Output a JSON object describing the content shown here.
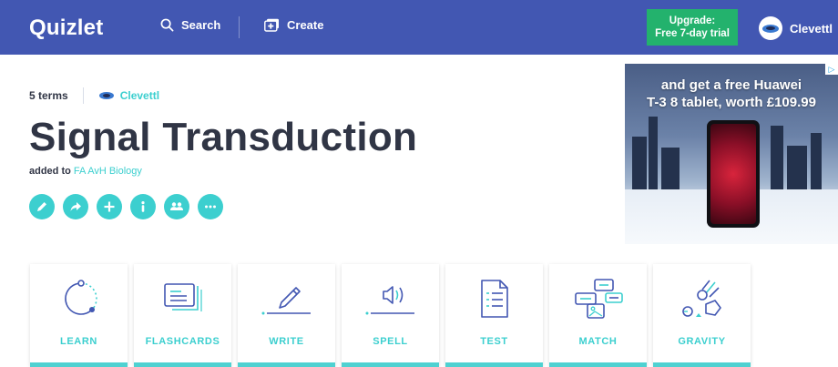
{
  "header": {
    "logo": "Quizlet",
    "search_label": "Search",
    "create_label": "Create",
    "upgrade_line1": "Upgrade:",
    "upgrade_line2": "Free 7-day trial",
    "username": "Clevettl"
  },
  "set": {
    "term_count": "5 terms",
    "creator": "Clevettl",
    "title": "Signal Transduction",
    "added_prefix": "added to",
    "folder": "FA AvH Biology"
  },
  "actions": [
    {
      "icon": "pencil-icon"
    },
    {
      "icon": "share-icon"
    },
    {
      "icon": "plus-icon"
    },
    {
      "icon": "info-icon"
    },
    {
      "icon": "people-icon"
    },
    {
      "icon": "more-icon"
    }
  ],
  "ad": {
    "line1": "and get a free Huawei",
    "line2": "T-3 8 tablet, worth £109.99",
    "badge": "▷"
  },
  "modes": [
    {
      "label": "LEARN",
      "icon": "learn-icon"
    },
    {
      "label": "FLASHCARDS",
      "icon": "flashcards-icon"
    },
    {
      "label": "WRITE",
      "icon": "write-icon"
    },
    {
      "label": "SPELL",
      "icon": "spell-icon"
    },
    {
      "label": "TEST",
      "icon": "test-icon"
    },
    {
      "label": "MATCH",
      "icon": "match-icon"
    },
    {
      "label": "GRAVITY",
      "icon": "gravity-icon"
    }
  ],
  "colors": {
    "header_bg": "#4257b2",
    "upgrade_bg": "#23b26d",
    "accent": "#3ccfcf",
    "text": "#303545"
  }
}
